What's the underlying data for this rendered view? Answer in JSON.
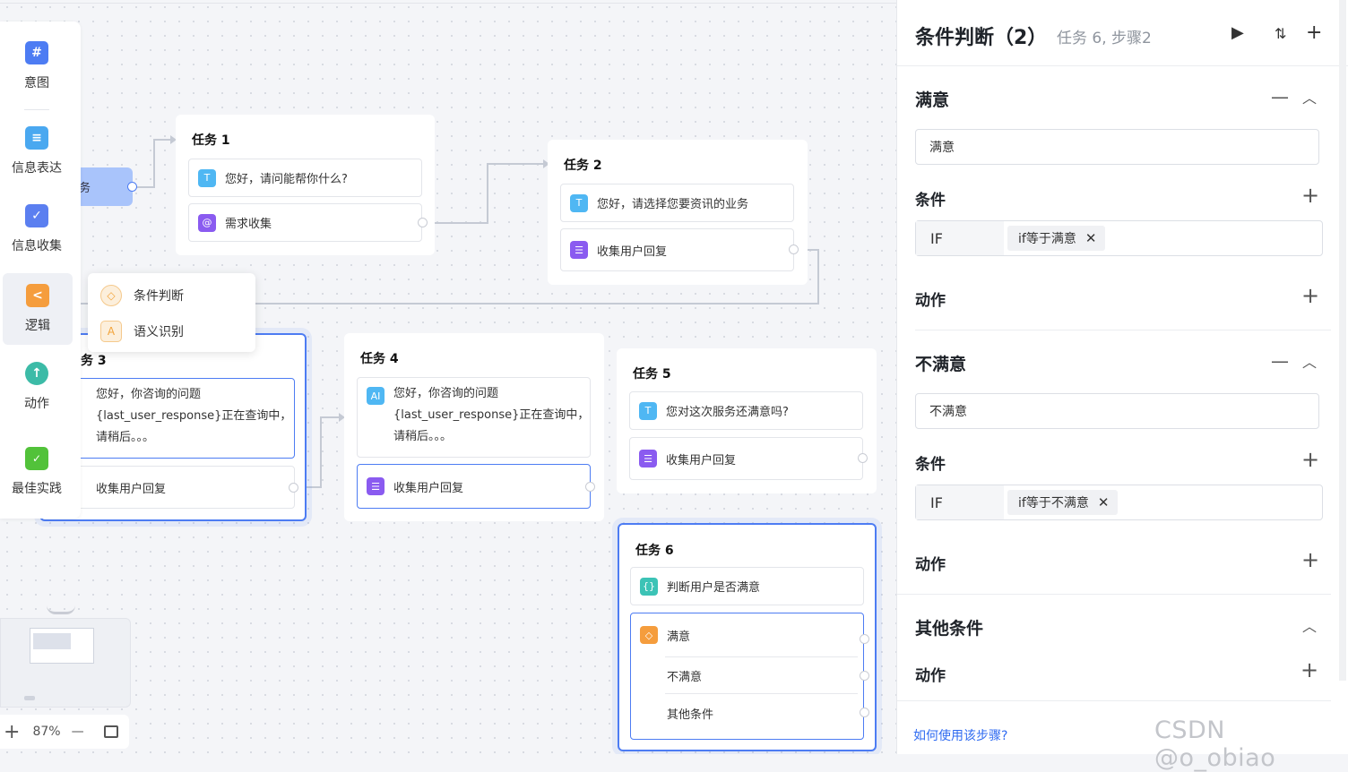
{
  "sidebar": {
    "items": [
      {
        "label": "意图",
        "icon": "hash-icon",
        "glyph": "#",
        "color": "#4d7cf3"
      },
      {
        "label": "信息表达",
        "icon": "message-icon",
        "glyph": "≡",
        "color": "#4aa8f0"
      },
      {
        "label": "信息收集",
        "icon": "check-box-icon",
        "glyph": "✓",
        "color": "#5b7ff0"
      },
      {
        "label": "逻辑",
        "icon": "share-icon",
        "glyph": "<",
        "color": "#f59d3d"
      },
      {
        "label": "动作",
        "icon": "arrow-up-icon",
        "glyph": "↑",
        "color": "#3cbba7"
      },
      {
        "label": "最佳实践",
        "icon": "thumbs-up-icon",
        "glyph": "👍",
        "color": "#52c23a"
      }
    ]
  },
  "popup": {
    "items": [
      {
        "label": "条件判断"
      },
      {
        "label": "语义识别"
      }
    ]
  },
  "chip_label": "务",
  "nodes": {
    "task1": {
      "title": "任务 1",
      "row1": "您好，请问能帮你什么?",
      "row2": "需求收集"
    },
    "task2": {
      "title": "任务 2",
      "row1": "您好，请选择您要资讯的业务",
      "row2": "收集用户回复"
    },
    "task3": {
      "title": "务 3",
      "row1": "您好，你咨询的问题{last_user_response}正在查询中，请稍后。。。",
      "row2": "收集用户回复"
    },
    "task4": {
      "title": "任务 4",
      "row1": "您好，你咨询的问题{last_user_response}正在查询中，请稍后。。。",
      "row2": "收集用户回复"
    },
    "task5": {
      "title": "任务 5",
      "row1": "您对这次服务还满意吗?",
      "row2": "收集用户回复"
    },
    "task6": {
      "title": "任务 6",
      "row1": "判断用户是否满意",
      "branches": [
        "满意",
        "不满意",
        "其他条件"
      ]
    }
  },
  "zoom": {
    "level": "87%",
    "minus": "—",
    "plus": "+"
  },
  "panel": {
    "title": "条件判断（2）",
    "subtitle": "任务 6, 步骤2",
    "sections": [
      {
        "name": "满意",
        "input_value": "满意",
        "cond_label": "条件",
        "if_label": "IF",
        "tag": "if等于满意",
        "action_label": "动作"
      },
      {
        "name": "不满意",
        "input_value": "不满意",
        "cond_label": "条件",
        "if_label": "IF",
        "tag": "if等于不满意",
        "action_label": "动作"
      }
    ],
    "other": {
      "name": "其他条件",
      "action_label": "动作"
    },
    "help_link": "如何使用该步骤?"
  },
  "watermark": "CSDN @o_obiao"
}
